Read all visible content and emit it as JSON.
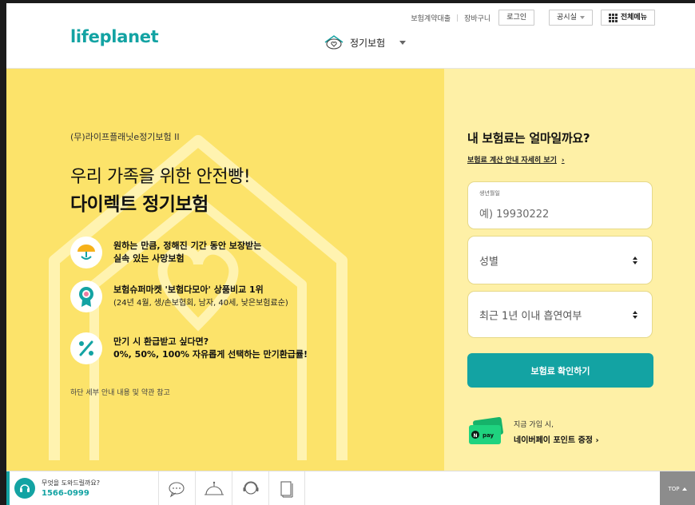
{
  "header": {
    "logo": "lifeplanet",
    "util_links": [
      "보험계약대출",
      "장바구니"
    ],
    "login_label": "로그인",
    "notice_label": "공시실",
    "all_menu_label": "전체메뉴",
    "product_label": "정기보험"
  },
  "hero": {
    "eyebrow": "(무)라이프플래닛e정기보험 II",
    "headline_line1": "우리 가족을 위한 안전빵!",
    "headline_line2": "다이렉트 정기보험",
    "features": [
      {
        "icon": "umbrella-icon",
        "line1": "원하는 만큼, 정해진 기간 동안 보장받는",
        "line2": "실속 있는 사망보험"
      },
      {
        "icon": "award-medal-icon",
        "line1": "보험슈퍼마켓 '보험다모아' 상품비교 1위",
        "line2": "(24년 4월, 생/손보협회, 남자, 40세, 낮은보험료순)"
      },
      {
        "icon": "percent-icon",
        "line1": "만기 시 환급받고 싶다면?",
        "line2": "0%, 50%, 100% 자유롭게 선택하는 만기환급률!"
      }
    ],
    "footnote": "하단 세부 안내 내용 및 약관 참고"
  },
  "calculator": {
    "title": "내 보험료는 얼마일까요?",
    "link": "보험료 계산 안내 자세히 보기",
    "birth_label": "생년월일",
    "birth_placeholder": "예) 19930222",
    "gender_placeholder": "성별",
    "smoking_placeholder": "최근 1년 이내 흡연여부",
    "submit_label": "보험료 확인하기",
    "promo_line1": "지금 가입 시,",
    "promo_line2": "네이버페이 포인트 증정",
    "promo_badge": "pay"
  },
  "bottom_bar": {
    "help_question": "무엇을 도와드릴까요?",
    "phone": "1566-0999",
    "tools": [
      "chat-icon",
      "consultant-icon",
      "agent-icon",
      "document-icon"
    ],
    "top_label": "TOP"
  },
  "colors": {
    "brand_teal": "#13a3a3",
    "hero_yellow": "#fce36a",
    "calc_yellow": "#fef0a6"
  }
}
